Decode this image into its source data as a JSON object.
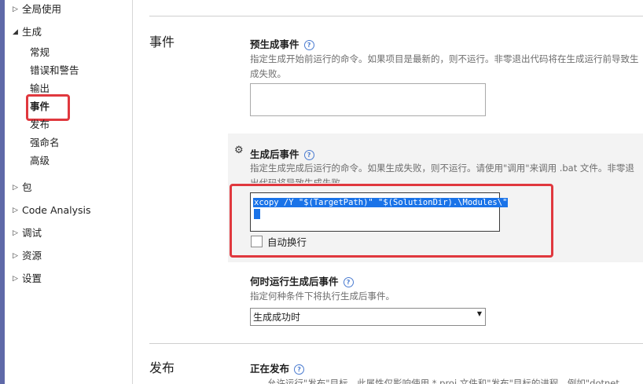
{
  "sidebar": {
    "global_usage": "全局使用",
    "build": "生成",
    "build_children": [
      "常规",
      "错误和警告",
      "输出",
      "事件",
      "发布",
      "强命名",
      "高级"
    ],
    "package": "包",
    "code_analysis": "Code Analysis",
    "debug": "调试",
    "resources": "资源",
    "settings": "设置"
  },
  "events_section": {
    "title": "事件",
    "pre_build": {
      "title": "预生成事件",
      "description": "指定生成开始前运行的命令。如果项目是最新的，则不运行。非零退出代码将在生成运行前导致生成失败。",
      "value": ""
    },
    "post_build": {
      "title": "生成后事件",
      "description": "指定生成完成后运行的命令。如果生成失败，则不运行。请使用\"调用\"来调用 .bat 文件。非零退出代码将导致生成失败。",
      "command": "xcopy /Y \"$(TargetPath)\" \"$(SolutionDir).\\Modules\\\"",
      "word_wrap_label": "自动换行"
    },
    "when_to_run": {
      "title": "何时运行生成后事件",
      "description": "指定何种条件下将执行生成后事件。",
      "selected": "生成成功时"
    }
  },
  "publish_section": {
    "title": "发布",
    "item_title": "正在发布",
    "description": "允许运行\"发布\"目标。此属性仅影响使用 *.proj 文件和\"发布\"目标的进程。例如\"dotnet"
  },
  "icons": {
    "help": "question-circle-icon",
    "settings": "gear-icon",
    "expand": "triangle-right-icon",
    "collapse": "triangle-down-icon",
    "dropdown": "chevron-down-icon"
  },
  "colors": {
    "highlight": "#e0383e",
    "selection": "#1a73e8",
    "strip": "#5f69a8"
  }
}
